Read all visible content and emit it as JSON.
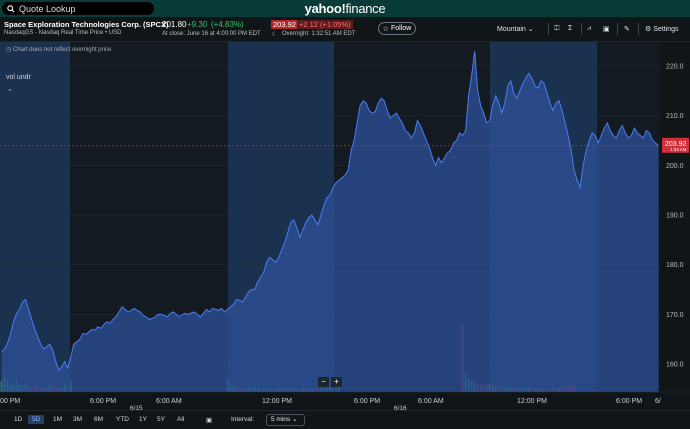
{
  "search": {
    "placeholder": "Quote Lookup"
  },
  "brand": {
    "name": "yahoo!",
    "section": "finance"
  },
  "quote": {
    "company": "Space Exploration Technologies Corp. (SPCX)",
    "exchange": "NasdaqGS - Nasdaq Real Time Price • USD",
    "price": "201.80",
    "change": "+9.30",
    "change_pct": "(+4.83%)",
    "close_info": "At close: June 16 at 4:00:00 PM EDT",
    "overnight_price": "203.92",
    "overnight_change": "+2.12",
    "overnight_change_pct": "(+1.05%)",
    "overnight_time": "Overnight: 1:32:51 AM EDT",
    "follow_label": "Follow"
  },
  "toolbar": {
    "theme_label": "Mountain",
    "settings_label": "Settings"
  },
  "chart_meta": {
    "overnight_note": "Chart does not reflect overnight price",
    "volume_ref_label": "vol undr",
    "price_badge": "203.92",
    "price_badge_time": "1:33 AM",
    "zoom_out": "−",
    "zoom_in": "+"
  },
  "chart_data": {
    "type": "area",
    "title": "",
    "xlabel": "",
    "ylabel": "",
    "ylim": [
      157,
      224
    ],
    "yticks": [
      160,
      170,
      180,
      190,
      200,
      210,
      220
    ],
    "xtick_labels": [
      "00 PM",
      "6:00 PM",
      "6:00 AM",
      "12:00 PM",
      "6:00 PM",
      "6:00 AM",
      "12:00 PM",
      "6:00 PM",
      "6/"
    ],
    "date_labels": [
      "6/15",
      "6/16"
    ],
    "series": [
      {
        "values": [
          162.5,
          163.0,
          164.2,
          166.0,
          168.5,
          170.2,
          171.0,
          172.5,
          173.0,
          171.0,
          169.0,
          167.0,
          165.5,
          164.0,
          163.0,
          163.5,
          164.0,
          162.8,
          160.5,
          158.8,
          159.5,
          160.5,
          159.2,
          161.5,
          164.0,
          164.5,
          165.0,
          166.2,
          166.0,
          166.5,
          167.0,
          166.8,
          167.5,
          167.2,
          168.0,
          168.5,
          168.2,
          169.0,
          169.5,
          170.5,
          171.5,
          171.0,
          170.5,
          170.8,
          171.2,
          170.8,
          170.5,
          169.8,
          169.5,
          169.0,
          169.2,
          169.5,
          170.0,
          170.0,
          169.8,
          169.5,
          170.2,
          170.5,
          170.0,
          169.5,
          170.0,
          170.2,
          170.0,
          170.3,
          170.5,
          170.0,
          169.5,
          170.2,
          171.0,
          170.5,
          171.2,
          171.0,
          170.8,
          171.2,
          170.5,
          171.0,
          171.5,
          172.0,
          173.0,
          172.8,
          172.5,
          173.5,
          174.5,
          175.0,
          175.0,
          176.5,
          177.5,
          178.5,
          180.5,
          181.5,
          181.0,
          180.5,
          181.5,
          183.0,
          184.5,
          186.5,
          188.5,
          189.0,
          187.5,
          185.5,
          187.0,
          188.5,
          189.5,
          190.0,
          189.0,
          188.0,
          190.0,
          192.0,
          193.5,
          194.0,
          195.5,
          196.5,
          197.0,
          197.5,
          198.0,
          199.0,
          203.0,
          205.0,
          208.5,
          212.0,
          213.0,
          212.5,
          211.0,
          210.5,
          210.8,
          212.5,
          213.5,
          213.0,
          211.0,
          209.5,
          210.0,
          210.5,
          209.5,
          208.5,
          207.0,
          206.5,
          205.5,
          206.5,
          209.0,
          208.0,
          206.5,
          205.0,
          203.5,
          201.5,
          200.0,
          201.5,
          200.5,
          201.5,
          202.5,
          203.0,
          204.5,
          205.0,
          206.5,
          206.0,
          207.0,
          214.0,
          218.0,
          223.0,
          215.0,
          212.0,
          210.5,
          208.5,
          209.0,
          212.0,
          214.0,
          212.5,
          210.5,
          212.5,
          216.0,
          217.0,
          214.5,
          213.5,
          215.0,
          216.5,
          217.5,
          218.5,
          217.5,
          216.0,
          215.5,
          217.0,
          216.5,
          214.5,
          212.5,
          211.0,
          212.5,
          213.0,
          211.0,
          208.5,
          206.0,
          203.0,
          199.0,
          197.0,
          195.5,
          200.0,
          203.0,
          205.0,
          206.5,
          206.0,
          204.5,
          206.0,
          207.5,
          208.5,
          207.0,
          206.0,
          205.5,
          207.0,
          208.0,
          206.5,
          205.5,
          206.0,
          207.5,
          206.5,
          206.0,
          205.5,
          207.0,
          206.5,
          205.0,
          204.5,
          203.92
        ]
      }
    ],
    "reference_line": 203.92,
    "volume_unit": "relative",
    "volume": [
      0.12,
      0.18,
      0.15,
      0.1,
      0.08,
      0.14,
      0.09,
      0.07,
      0.1,
      0.06,
      0.05,
      0.08,
      0.07,
      0.05,
      0.06,
      0.05,
      0.09,
      0.07,
      0.05,
      0.06,
      0.04,
      0.08,
      0.05,
      0.12,
      0,
      0,
      0,
      0,
      0,
      0,
      0,
      0,
      0,
      0,
      0,
      0,
      0,
      0,
      0,
      0,
      0,
      0,
      0,
      0,
      0,
      0,
      0,
      0,
      0,
      0,
      0,
      0,
      0,
      0,
      0,
      0,
      0,
      0,
      0,
      0,
      0,
      0,
      0,
      0,
      0,
      0,
      0,
      0,
      0,
      0,
      0,
      0,
      0,
      0,
      0,
      0.15,
      0.08,
      0.07,
      0.06,
      0.05,
      0.05,
      0.04,
      0.05,
      0.04,
      0.05,
      0.04,
      0.03,
      0.04,
      0.05,
      0.04,
      0.03,
      0.04,
      0.05,
      0.04,
      0.04,
      0.03,
      0.04,
      0.05,
      0.04,
      0.04,
      0.05,
      0.04,
      0.03,
      0.04,
      0.05,
      0.04,
      0.05,
      0.04,
      0.06,
      0.05,
      0.04,
      0.05,
      0.07,
      0,
      0,
      0,
      0,
      0,
      0,
      0,
      0,
      0,
      0,
      0,
      0,
      0,
      0,
      0,
      0,
      0,
      0,
      0,
      0,
      0,
      0,
      0,
      0,
      0,
      0,
      0,
      0,
      0,
      0,
      0,
      0,
      0,
      0,
      0,
      0,
      0,
      0,
      0,
      0,
      0.75,
      0.2,
      0.15,
      0.12,
      0.1,
      0.09,
      0.08,
      0.07,
      0.08,
      0.09,
      0.07,
      0.06,
      0.07,
      0.06,
      0.05,
      0.06,
      0.05,
      0.06,
      0.05,
      0.05,
      0.04,
      0.05,
      0.06,
      0.05,
      0.04,
      0.05,
      0.04,
      0.05,
      0.04,
      0.04,
      0.05,
      0.04,
      0.05,
      0.06,
      0.05,
      0.07,
      0.08,
      0.1,
      0,
      0,
      0,
      0,
      0,
      0,
      0,
      0,
      0,
      0,
      0,
      0,
      0,
      0,
      0,
      0,
      0,
      0,
      0,
      0,
      0,
      0,
      0,
      0,
      0,
      0
    ],
    "grid": true
  },
  "ranges": [
    {
      "label": "1D",
      "active": false
    },
    {
      "label": "5D",
      "active": true
    },
    {
      "label": "1M",
      "active": false
    },
    {
      "label": "3M",
      "active": false
    },
    {
      "label": "6M",
      "active": false
    },
    {
      "label": "YTD",
      "active": false
    },
    {
      "label": "1Y",
      "active": false
    },
    {
      "label": "5Y",
      "active": false
    },
    {
      "label": "All",
      "active": false
    }
  ],
  "interval": {
    "label": "Interval:",
    "value": "5 mins"
  },
  "colors": {
    "accent": "#3d6ee0",
    "session_band": "#1b3150",
    "offhours_band": "#131a21",
    "area_fill": "#2c4f96",
    "line": "#4c7cf0",
    "up": "#3dbd6b",
    "down": "#b5252c"
  }
}
